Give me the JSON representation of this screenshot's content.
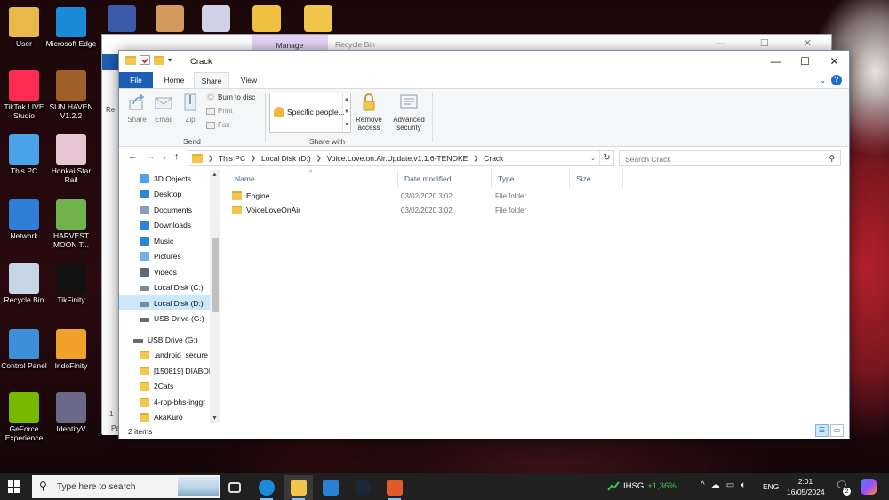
{
  "desktop": {
    "icons": [
      {
        "label": "User",
        "color": "#e8b84a"
      },
      {
        "label": "Microsoft Edge",
        "color": "#1b8ad8"
      },
      {
        "label": "TikTok LIVE Studio",
        "color": "#fe2c55"
      },
      {
        "label": "SUN HAVEN V1.2.2",
        "color": "#a0602a"
      },
      {
        "label": "This PC",
        "color": "#4aa3e8"
      },
      {
        "label": "Honkai Star Rail",
        "color": "#e6c6d2"
      },
      {
        "label": "Network",
        "color": "#2f7fd6"
      },
      {
        "label": "HARVEST MOON T...",
        "color": "#6fb34a"
      },
      {
        "label": "Recycle Bin",
        "color": "#c7d6e6"
      },
      {
        "label": "TikFinity",
        "color": "#111111"
      },
      {
        "label": "Control Panel",
        "color": "#3c8fd9"
      },
      {
        "label": "IndoFinity",
        "color": "#f1a02a"
      },
      {
        "label": "GeForce Experience",
        "color": "#76b900"
      },
      {
        "label": "IdentityV",
        "color": "#6a6a88"
      }
    ],
    "top_row_colors": [
      "#3b5aa8",
      "#d49a5c",
      "#cfd2e6",
      "#f0c040",
      "#f2c54b"
    ]
  },
  "background_window": {
    "manage_tab": "Manage",
    "title": "Recycle Bin",
    "peek_labels": [
      "Bi",
      "Re",
      "1 i",
      "Pa"
    ]
  },
  "window": {
    "title": "Crack",
    "controls": {
      "minimize": "—",
      "maximize": "☐",
      "close": "✕"
    },
    "tabs": {
      "file": "File",
      "home": "Home",
      "share": "Share",
      "view": "View"
    },
    "ribbon": {
      "send": {
        "share": "Share",
        "email": "Email",
        "zip": "Zip",
        "burn": "Burn to disc",
        "print": "Print",
        "fax": "Fax",
        "group_label": "Send"
      },
      "share_with": {
        "selected": "Specific people...",
        "remove_access": "Remove access",
        "advanced_security": "Advanced security",
        "group_label": "Share with"
      }
    },
    "address": {
      "crumbs": [
        "This PC",
        "Local Disk (D:)",
        "Voice.Love.on.Air.Update.v1.1.6-TENOKE",
        "Crack"
      ],
      "search_placeholder": "Search Crack"
    },
    "nav": [
      {
        "label": "3D Objects",
        "icon": "cube-icon",
        "color": "#4aa3e8",
        "level": "child"
      },
      {
        "label": "Desktop",
        "icon": "desktop-icon",
        "color": "#2c84d6",
        "level": "child"
      },
      {
        "label": "Documents",
        "icon": "documents-icon",
        "color": "#8aa0b8",
        "level": "child"
      },
      {
        "label": "Downloads",
        "icon": "download-icon",
        "color": "#2c84d6",
        "level": "child"
      },
      {
        "label": "Music",
        "icon": "music-icon",
        "color": "#2c84d6",
        "level": "child"
      },
      {
        "label": "Pictures",
        "icon": "pictures-icon",
        "color": "#6fb3e8",
        "level": "child"
      },
      {
        "label": "Videos",
        "icon": "videos-icon",
        "color": "#5a6a7a",
        "level": "child"
      },
      {
        "label": "Local Disk (C:)",
        "icon": "drive-icon",
        "color": "#7a8a9a",
        "level": "child"
      },
      {
        "label": "Local Disk (D:)",
        "icon": "drive-icon",
        "color": "#7a8a9a",
        "level": "child",
        "selected": true
      },
      {
        "label": "USB Drive (G:)",
        "icon": "usb-drive-icon",
        "color": "#6a6a6a",
        "level": "child"
      },
      {
        "label": "USB Drive (G:)",
        "icon": "usb-drive-icon",
        "color": "#6a6a6a",
        "level": "root"
      },
      {
        "label": ".android_secure",
        "icon": "folder-icon",
        "color": "#f2c54b",
        "level": "child"
      },
      {
        "label": "[150819] DIABOL",
        "icon": "folder-icon",
        "color": "#f2c54b",
        "level": "child"
      },
      {
        "label": "2Cats",
        "icon": "folder-icon",
        "color": "#f2c54b",
        "level": "child"
      },
      {
        "label": "4-rpp-bhs-inggr",
        "icon": "folder-icon",
        "color": "#f2c54b",
        "level": "child"
      },
      {
        "label": "AkaKuro",
        "icon": "folder-icon",
        "color": "#f2c54b",
        "level": "child"
      }
    ],
    "columns": {
      "name": "Name",
      "date": "Date modified",
      "type": "Type",
      "size": "Size"
    },
    "files": [
      {
        "name": "Engine",
        "date": "03/02/2020 3:02",
        "type": "File folder"
      },
      {
        "name": "VoiceLoveOnAir",
        "date": "03/02/2020 3:02",
        "type": "File folder"
      }
    ],
    "status": {
      "count": "2 items"
    }
  },
  "taskbar": {
    "search_placeholder": "Type here to search",
    "apps": [
      {
        "name": "task-view",
        "color": "#dddddd"
      },
      {
        "name": "edge",
        "color": "#1b8ad8"
      },
      {
        "name": "file-explorer",
        "color": "#f2c54b"
      },
      {
        "name": "mail",
        "color": "#2a7fd4"
      },
      {
        "name": "steam",
        "color": "#1b2838"
      },
      {
        "name": "app",
        "color": "#e05a2a"
      }
    ],
    "stock": {
      "symbol": "IHSG",
      "change": "+1,36%"
    },
    "language": "ENG",
    "time": "2:01",
    "date": "16/05/2024",
    "notification_count": "2"
  }
}
